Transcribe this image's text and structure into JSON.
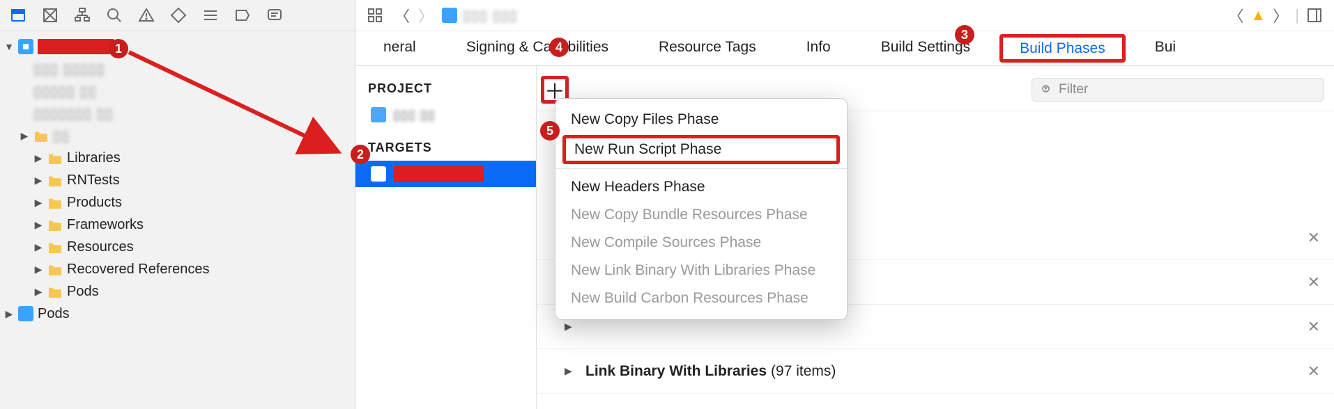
{
  "sidebar": {
    "tree": {
      "project_name_redacted": true,
      "blurred_items": [
        "▯▯▯ ▯▯▯▯▯",
        "▯▯▯▯▯ ▯▯",
        "▯▯▯▯▯▯▯ ▯▯"
      ],
      "group_icon_row": "▯▯",
      "folders": [
        "Libraries",
        "RNTests",
        "Products",
        "Frameworks",
        "Resources",
        "Recovered References",
        "Pods"
      ],
      "pods_project": "Pods"
    }
  },
  "editor": {
    "breadcrumb_blur": "▯▯▯ ▯▯▯",
    "tabs": [
      "neral",
      "Signing & Capabilities",
      "Resource Tags",
      "Info",
      "Build Settings",
      "Build Phases",
      "Bui"
    ],
    "active_tab": "Build Phases"
  },
  "project_targets": {
    "project_header": "PROJECT",
    "project_name_blur": "▯▯▯ ▯▯",
    "targets_header": "TARGETS",
    "selected_target_redacted": true
  },
  "filter": {
    "placeholder": "Filter"
  },
  "popup": {
    "items": [
      {
        "label": "New Copy Files Phase",
        "enabled": true
      },
      {
        "label": "New Run Script Phase",
        "enabled": true,
        "highlight": true
      },
      {
        "label": "New Headers Phase",
        "enabled": true,
        "separator_before": true
      },
      {
        "label": "New Copy Bundle Resources Phase",
        "enabled": false
      },
      {
        "label": "New Compile Sources Phase",
        "enabled": false
      },
      {
        "label": "New Link Binary With Libraries Phase",
        "enabled": false
      },
      {
        "label": "New Build Carbon Resources Phase",
        "enabled": false
      }
    ]
  },
  "phases": [
    {
      "label": "",
      "count": ""
    },
    {
      "label": "",
      "count": ""
    },
    {
      "label": "",
      "count": ""
    },
    {
      "label": "Link Binary With Libraries",
      "count": "(97 items)"
    }
  ],
  "markers": {
    "1": "1",
    "2": "2",
    "3": "3",
    "4": "4",
    "5": "5"
  }
}
